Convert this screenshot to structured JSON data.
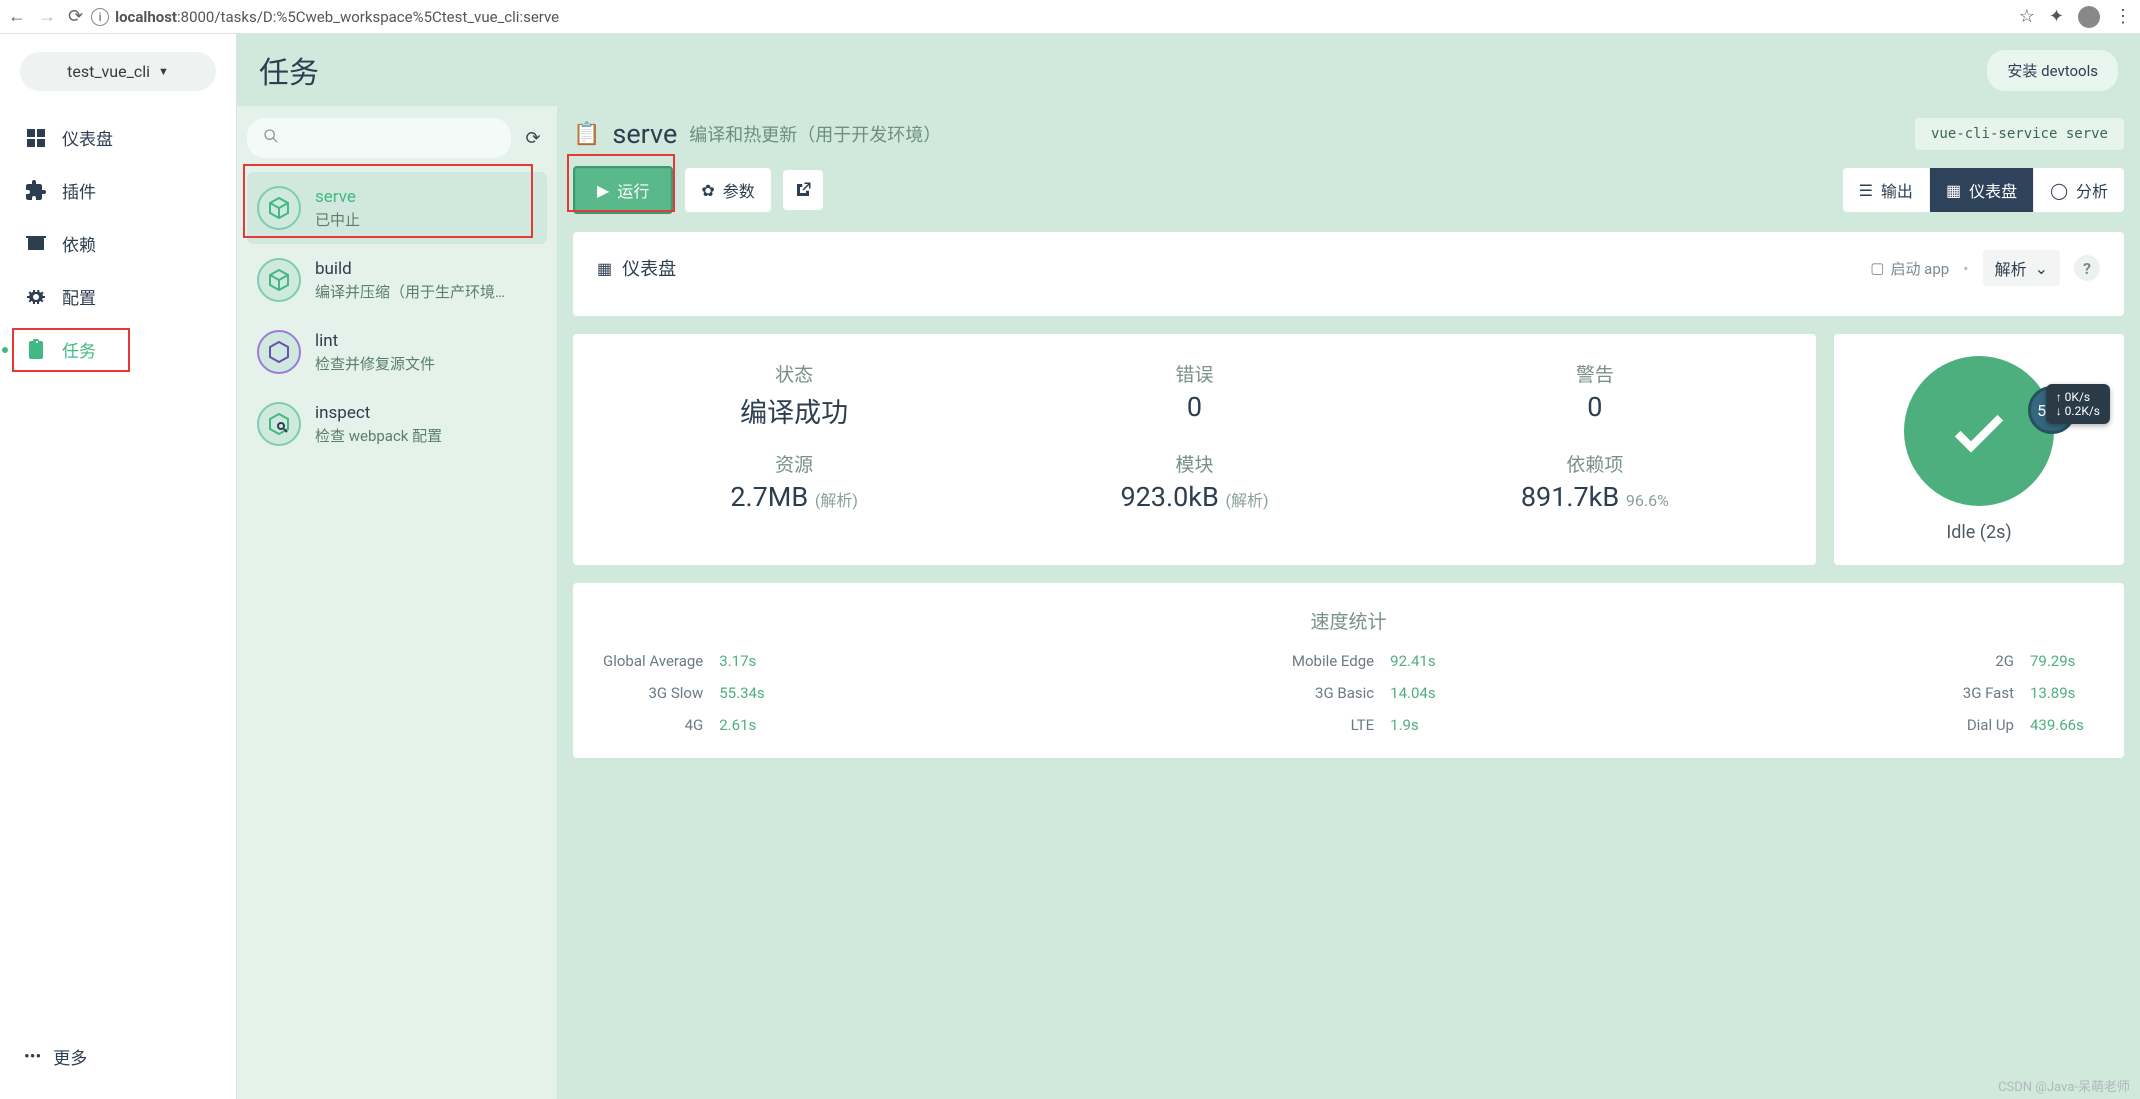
{
  "browser": {
    "url_host": "localhost",
    "url_rest": ":8000/tasks/D:%5Cweb_workspace%5Ctest_vue_cli:serve"
  },
  "project_name": "test_vue_cli",
  "nav": {
    "dashboard": "仪表盘",
    "plugins": "插件",
    "deps": "依赖",
    "config": "配置",
    "tasks": "任务",
    "more": "更多"
  },
  "page_title": "任务",
  "install_devtools": "安装 devtools",
  "search_placeholder": "",
  "tasks": [
    {
      "name": "serve",
      "sub": "已中止"
    },
    {
      "name": "build",
      "sub": "编译并压缩（用于生产环境…"
    },
    {
      "name": "lint",
      "sub": "检查并修复源文件"
    },
    {
      "name": "inspect",
      "sub": "检查 webpack 配置"
    }
  ],
  "detail": {
    "name": "serve",
    "desc": "编译和热更新（用于开发环境）",
    "cmd": "vue-cli-service serve",
    "run": "运行",
    "params": "参数",
    "output": "输出",
    "dashboard": "仪表盘",
    "analyze": "分析",
    "dash_title": "仪表盘",
    "launch_app": "启动 app",
    "parse": "解析"
  },
  "stats": {
    "status_label": "状态",
    "status_value": "编译成功",
    "errors_label": "错误",
    "errors_value": "0",
    "warnings_label": "警告",
    "warnings_value": "0",
    "assets_label": "资源",
    "assets_value": "2.7MB",
    "assets_note": "(解析)",
    "modules_label": "模块",
    "modules_value": "923.0kB",
    "modules_note": "(解析)",
    "deps_label": "依赖项",
    "deps_value": "891.7kB",
    "deps_note": "96.6%"
  },
  "gauge": {
    "pct": "55%",
    "up": "0K/s",
    "down": "0.2K/s",
    "idle": "Idle (2s)"
  },
  "speed": {
    "title": "速度统计",
    "col1": [
      {
        "k": "Global Average",
        "v": "3.17s"
      },
      {
        "k": "3G Slow",
        "v": "55.34s"
      },
      {
        "k": "4G",
        "v": "2.61s"
      }
    ],
    "col2": [
      {
        "k": "Mobile Edge",
        "v": "92.41s"
      },
      {
        "k": "3G Basic",
        "v": "14.04s"
      },
      {
        "k": "LTE",
        "v": "1.9s"
      }
    ],
    "col3": [
      {
        "k": "2G",
        "v": "79.29s"
      },
      {
        "k": "3G Fast",
        "v": "13.89s"
      },
      {
        "k": "Dial Up",
        "v": "439.66s"
      }
    ]
  },
  "watermark": "CSDN @Java-呆萌老师"
}
